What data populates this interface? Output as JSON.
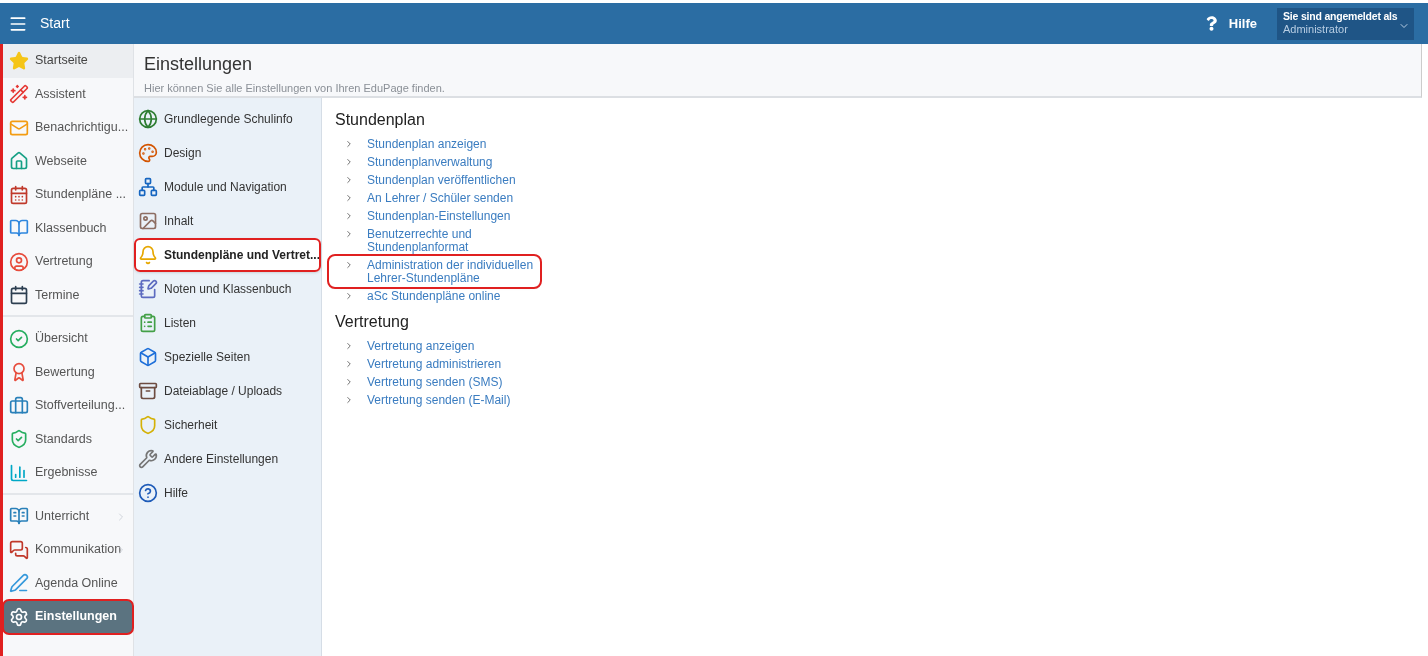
{
  "topbar": {
    "title": "Start",
    "help": "Hilfe",
    "account": {
      "label": "Sie sind angemeldet als",
      "value": "Administrator"
    }
  },
  "sidebar": {
    "groups": [
      {
        "items": [
          {
            "label": "Startseite",
            "selected": false,
            "hovered": true,
            "highlighted": false,
            "has_submenu": false
          },
          {
            "label": "Assistent",
            "selected": false,
            "hovered": false,
            "highlighted": false,
            "has_submenu": false
          },
          {
            "label": "Benachrichtigu...",
            "selected": false,
            "hovered": false,
            "highlighted": false,
            "has_submenu": false
          },
          {
            "label": "Webseite",
            "selected": false,
            "hovered": false,
            "highlighted": false,
            "has_submenu": false
          },
          {
            "label": "Stundenpläne ...",
            "selected": false,
            "hovered": false,
            "highlighted": false,
            "has_submenu": false
          },
          {
            "label": "Klassenbuch",
            "selected": false,
            "hovered": false,
            "highlighted": false,
            "has_submenu": false
          },
          {
            "label": "Vertretung",
            "selected": false,
            "hovered": false,
            "highlighted": false,
            "has_submenu": false
          },
          {
            "label": "Termine",
            "selected": false,
            "hovered": false,
            "highlighted": false,
            "has_submenu": false
          }
        ]
      },
      {
        "items": [
          {
            "label": "Übersicht",
            "selected": false,
            "hovered": false,
            "highlighted": false,
            "has_submenu": false
          },
          {
            "label": "Bewertung",
            "selected": false,
            "hovered": false,
            "highlighted": false,
            "has_submenu": false
          },
          {
            "label": "Stoffverteilung...",
            "selected": false,
            "hovered": false,
            "highlighted": false,
            "has_submenu": false
          },
          {
            "label": "Standards",
            "selected": false,
            "hovered": false,
            "highlighted": false,
            "has_submenu": false
          },
          {
            "label": "Ergebnisse",
            "selected": false,
            "hovered": false,
            "highlighted": false,
            "has_submenu": false
          }
        ]
      },
      {
        "items": [
          {
            "label": "Unterricht",
            "selected": false,
            "hovered": false,
            "highlighted": false,
            "has_submenu": true
          },
          {
            "label": "Kommunikation",
            "selected": false,
            "hovered": false,
            "highlighted": false,
            "has_submenu": true
          },
          {
            "label": "Agenda Online",
            "selected": false,
            "hovered": false,
            "highlighted": false,
            "has_submenu": false
          },
          {
            "label": "Einstellungen",
            "selected": true,
            "hovered": false,
            "highlighted": true,
            "has_submenu": false
          }
        ]
      }
    ]
  },
  "page": {
    "title": "Einstellungen",
    "subtitle": "Hier können Sie alle Einstellungen von Ihren EduPage finden."
  },
  "categories": [
    {
      "label": "Grundlegende Schulinfo",
      "selected": false,
      "highlighted": false
    },
    {
      "label": "Design",
      "selected": false,
      "highlighted": false
    },
    {
      "label": "Module und Navigation",
      "selected": false,
      "highlighted": false
    },
    {
      "label": "Inhalt",
      "selected": false,
      "highlighted": false
    },
    {
      "label": "Stundenpläne und Vertret...",
      "selected": true,
      "highlighted": true
    },
    {
      "label": "Noten und Klassenbuch",
      "selected": false,
      "highlighted": false
    },
    {
      "label": "Listen",
      "selected": false,
      "highlighted": false
    },
    {
      "label": "Spezielle Seiten",
      "selected": false,
      "highlighted": false
    },
    {
      "label": "Dateiablage / Uploads",
      "selected": false,
      "highlighted": false
    },
    {
      "label": "Sicherheit",
      "selected": false,
      "highlighted": false
    },
    {
      "label": "Andere Einstellungen",
      "selected": false,
      "highlighted": false
    },
    {
      "label": "Hilfe",
      "selected": false,
      "highlighted": false
    }
  ],
  "sections": [
    {
      "title": "Stundenplan",
      "links": [
        {
          "label": "Stundenplan anzeigen",
          "highlighted": false
        },
        {
          "label": "Stundenplanverwaltung",
          "highlighted": false
        },
        {
          "label": "Stundenplan veröffentlichen",
          "highlighted": false
        },
        {
          "label": "An Lehrer / Schüler senden",
          "highlighted": false
        },
        {
          "label": "Stundenplan-Einstellungen",
          "highlighted": false
        },
        {
          "label": "Benutzerrechte und Stundenplanformat",
          "highlighted": false
        },
        {
          "label": "Administration der individuellen Lehrer-Stundenpläne",
          "highlighted": true
        },
        {
          "label": "aSc Stundenpläne online",
          "highlighted": false
        }
      ]
    },
    {
      "title": "Vertretung",
      "links": [
        {
          "label": "Vertretung anzeigen",
          "highlighted": false
        },
        {
          "label": "Vertretung administrieren",
          "highlighted": false
        },
        {
          "label": "Vertretung senden (SMS)",
          "highlighted": false
        },
        {
          "label": "Vertretung senden (E-Mail)",
          "highlighted": false
        }
      ]
    }
  ]
}
